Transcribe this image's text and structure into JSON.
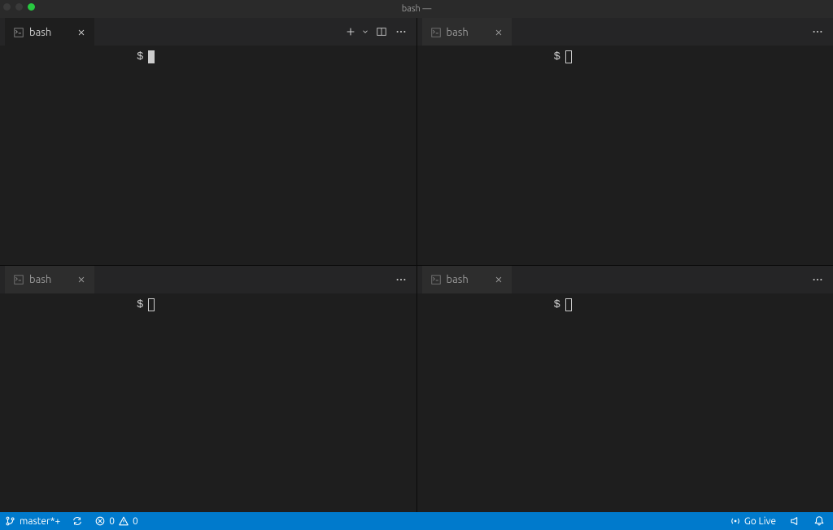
{
  "window": {
    "title": "bash —"
  },
  "panes": [
    {
      "tab_label": "bash",
      "prompt": "$",
      "active": true,
      "has_new_actions": true
    },
    {
      "tab_label": "bash",
      "prompt": "$",
      "active": false,
      "has_new_actions": false
    },
    {
      "tab_label": "bash",
      "prompt": "$",
      "active": false,
      "has_new_actions": false
    },
    {
      "tab_label": "bash",
      "prompt": "$",
      "active": false,
      "has_new_actions": false
    }
  ],
  "statusbar": {
    "branch": "master*+",
    "errors": "0",
    "warnings": "0",
    "go_live": "Go Live"
  }
}
